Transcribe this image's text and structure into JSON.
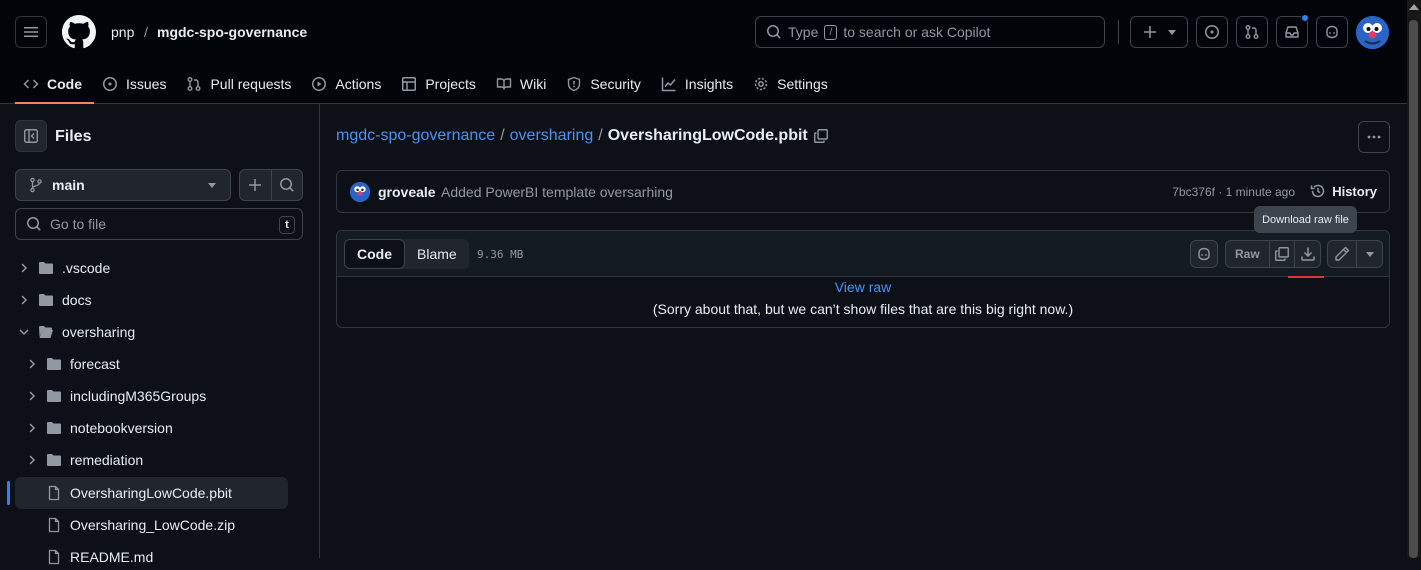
{
  "header": {
    "owner": "pnp",
    "separator": "/",
    "repo": "mgdc-spo-governance",
    "search_prefix": "Type",
    "search_key": "/",
    "search_suffix": "to search or ask Copilot"
  },
  "nav_tabs": [
    {
      "label": "Code",
      "icon": "code-icon",
      "active": true
    },
    {
      "label": "Issues",
      "icon": "issue-icon"
    },
    {
      "label": "Pull requests",
      "icon": "pull-request-icon"
    },
    {
      "label": "Actions",
      "icon": "play-icon"
    },
    {
      "label": "Projects",
      "icon": "table-icon"
    },
    {
      "label": "Wiki",
      "icon": "book-icon"
    },
    {
      "label": "Security",
      "icon": "shield-icon"
    },
    {
      "label": "Insights",
      "icon": "graph-icon"
    },
    {
      "label": "Settings",
      "icon": "gear-icon"
    }
  ],
  "sidebar": {
    "title": "Files",
    "branch": "main",
    "goto_placeholder": "Go to file",
    "goto_shortcut": "t",
    "tree": [
      {
        "label": ".vscode",
        "type": "folder",
        "expanded": false
      },
      {
        "label": "docs",
        "type": "folder",
        "expanded": false
      },
      {
        "label": "oversharing",
        "type": "folder",
        "expanded": true
      },
      {
        "label": "forecast",
        "type": "folder",
        "expanded": false
      },
      {
        "label": "includingM365Groups",
        "type": "folder",
        "expanded": false
      },
      {
        "label": "notebookversion",
        "type": "folder",
        "expanded": false
      },
      {
        "label": "remediation",
        "type": "folder",
        "expanded": false
      },
      {
        "label": "OversharingLowCode.pbit",
        "type": "file",
        "selected": true
      },
      {
        "label": "Oversharing_LowCode.zip",
        "type": "file"
      },
      {
        "label": "README.md",
        "type": "file"
      }
    ]
  },
  "main": {
    "breadcrumb": {
      "repo": "mgdc-spo-governance",
      "folder": "oversharing",
      "file": "OversharingLowCode.pbit",
      "sep": "/"
    },
    "commit": {
      "author": "groveale",
      "message": "Added PowerBI template oversarhing",
      "meta": "7bc376f · 1 minute ago",
      "history_label": "History"
    },
    "tooltip": "Download raw file",
    "file": {
      "tab_code": "Code",
      "tab_blame": "Blame",
      "size": "9.36 MB",
      "raw_label": "Raw",
      "view_raw": "View raw",
      "too_big": "(Sorry about that, but we can’t show files that are this big right now.)"
    }
  },
  "colors": {
    "background": "#0d1117",
    "header_bg": "#010409",
    "link": "#4493f8",
    "active_tab_underline": "#f78166",
    "selection_bar": "#2f81f7",
    "notification_dot": "#2f81f7"
  }
}
